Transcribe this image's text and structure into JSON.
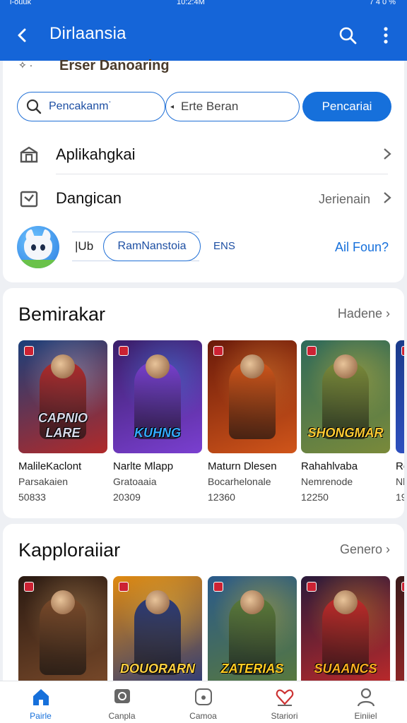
{
  "status": {
    "left": "l-ouuk",
    "center": "10:2:4M",
    "right": "7 4 0 %"
  },
  "appbar": {
    "title": "Dirlaansia",
    "back_icon": "back-arrow-icon",
    "search_icon": "search-icon",
    "more_icon": "more-vert-icon"
  },
  "top_card": {
    "partial_heading": "Erser Danoaring",
    "search": {
      "field1": "Pencakanm˙",
      "field2": "Erte Beran",
      "button": "Pencariai"
    },
    "rows": [
      {
        "label": "Aplikahgkai",
        "value": "",
        "icon": "storefront-icon"
      },
      {
        "label": "Dangican",
        "value": "Jerienain",
        "icon": "inbox-icon"
      }
    ],
    "profile": {
      "seg_label": "|Ub",
      "pill": "RamNanstoia",
      "tag": "ENS",
      "link": "Ail Foun?",
      "avatar": "cat-mascot-avatar"
    }
  },
  "sections": [
    {
      "title": "Bemirakar",
      "more": "Hadene",
      "games": [
        {
          "name": "MalileKaclont",
          "genre": "Parsakaien",
          "count": "50833",
          "logo": "CAPNIO LARE",
          "palette": [
            "#1b3f7a",
            "#b02a2a",
            "#d8d8e8"
          ]
        },
        {
          "name": "Narlte Mlapp",
          "genre": "Gratoaaia",
          "count": "20309",
          "logo": "KUHNG",
          "palette": [
            "#3a1f6a",
            "#7a3fd0",
            "#33aaff"
          ]
        },
        {
          "name": "Maturn Dlesen",
          "genre": "Bocarhelonale",
          "count": "12360",
          "logo": "",
          "palette": [
            "#6a1a0a",
            "#d0551a",
            "#ffaa44"
          ]
        },
        {
          "name": "Rahahlvaba",
          "genre": "Nemrenode",
          "count": "12250",
          "logo": "SHONGMAR",
          "palette": [
            "#2f6a5a",
            "#7a8a3a",
            "#ffcc33"
          ]
        },
        {
          "name": "Ro",
          "genre": "Nl",
          "count": "19",
          "logo": "",
          "palette": [
            "#1a3a8a",
            "#3355cc",
            "#ff8833"
          ]
        }
      ]
    },
    {
      "title": "Kapploraiiar",
      "more": "Genero",
      "games": [
        {
          "name": "",
          "genre": "",
          "count": "",
          "logo": "",
          "palette": [
            "#2a1a12",
            "#7a4a2a",
            "#e0b070"
          ]
        },
        {
          "name": "",
          "genre": "",
          "count": "",
          "logo": "DOUORARN",
          "palette": [
            "#e08a10",
            "#2a3a7a",
            "#ffd040"
          ]
        },
        {
          "name": "",
          "genre": "",
          "count": "",
          "logo": "ZATERIAS",
          "palette": [
            "#2a5a8a",
            "#5a7a3a",
            "#ffcc22"
          ]
        },
        {
          "name": "",
          "genre": "",
          "count": "",
          "logo": "SUAANCS",
          "palette": [
            "#2a1a3a",
            "#c02a2a",
            "#ffb020"
          ]
        },
        {
          "name": "",
          "genre": "",
          "count": "",
          "logo": "",
          "palette": [
            "#3a1a1a",
            "#aa2a2a",
            "#ffaa33"
          ]
        }
      ]
    }
  ],
  "nav": [
    {
      "label": "Pairle",
      "icon": "home-icon"
    },
    {
      "label": "Canpla",
      "icon": "chat-icon"
    },
    {
      "label": "Camoa",
      "icon": "camera-icon"
    },
    {
      "label": "Stariori",
      "icon": "heart-icon"
    },
    {
      "label": "Einiiel",
      "icon": "profile-icon"
    }
  ],
  "colors": {
    "primary": "#1565d8",
    "accent": "#1670db",
    "background": "#eef0f4"
  }
}
